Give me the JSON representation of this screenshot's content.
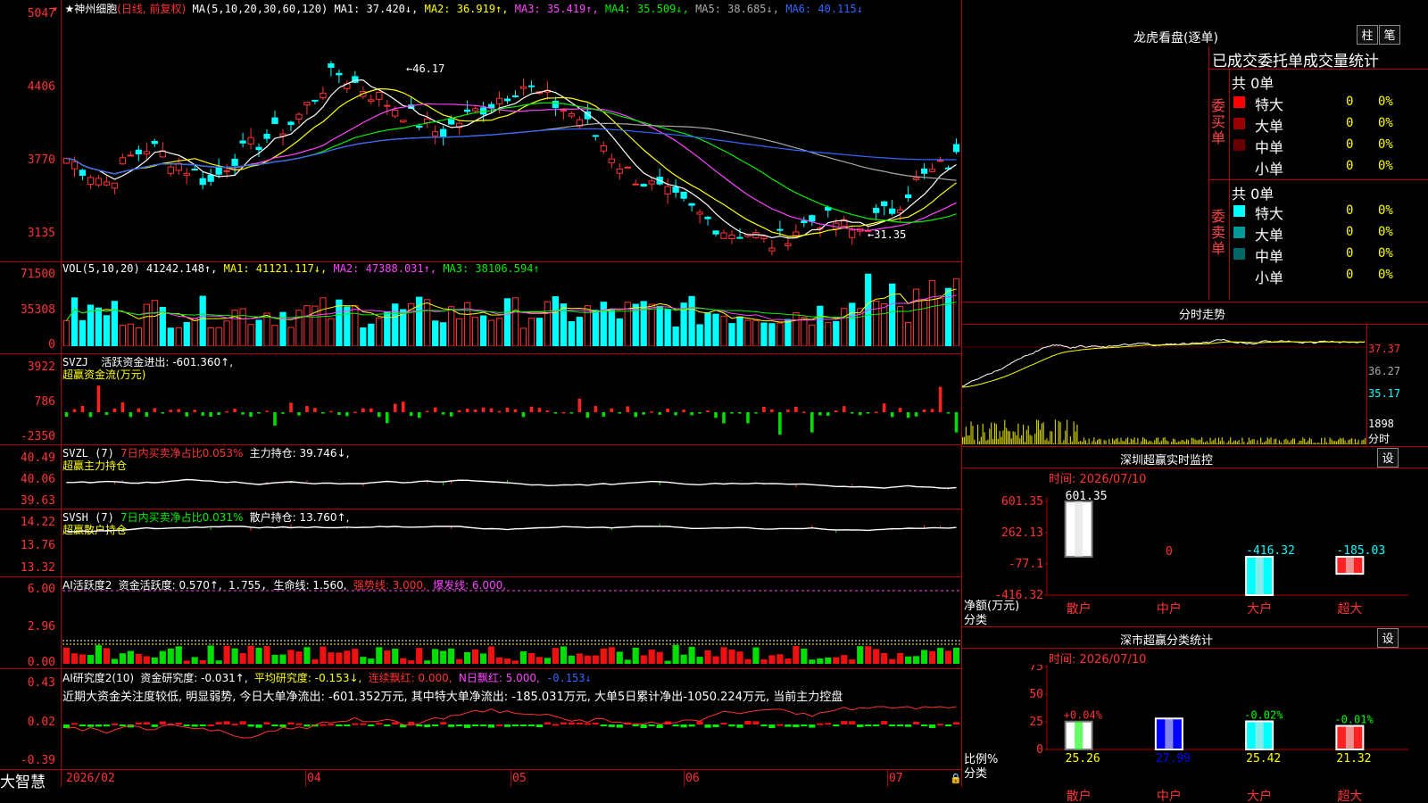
{
  "stock": {
    "name": "神州细胞",
    "mode": "(日线, 前复权)"
  },
  "ma_header": {
    "params": "MA(5,10,20,30,60,120)",
    "ma1": "MA1: 37.420↓,",
    "ma2": "MA2: 36.919↑,",
    "ma3": "MA3: 35.419↑,",
    "ma4": "MA4: 35.509↓,",
    "ma5": "MA5: 38.685↓,",
    "ma6": "MA6: 40.115↓"
  },
  "price_axis": [
    "5047",
    "4406",
    "3770",
    "3135"
  ],
  "price_notes": {
    "high": "46.17",
    "low": "31.35"
  },
  "vol": {
    "header": "VOL(5,10,20)",
    "val": "41242.148↑,",
    "ma1": "MA1: 41121.117↓,",
    "ma2": "MA2: 47388.031↑,",
    "ma3": "MA3: 38106.594↑",
    "axis": [
      "71500",
      "35308",
      "0"
    ]
  },
  "svzj": {
    "title": "SVZJ",
    "label": "活跃资金进出: -601.360↑,",
    "sub": "超赢资金流(万元)",
    "axis": [
      "3922",
      "786",
      "-2350"
    ]
  },
  "svzl": {
    "title": "SVZL (7)",
    "ratio": "7日内买卖净占比0.053%",
    "hold": "主力持仓: 39.746↓,",
    "sub": "超赢主力持仓",
    "axis": [
      "40.49",
      "40.06",
      "39.63"
    ]
  },
  "svsh": {
    "title": "SVSH (7)",
    "ratio": "7日内买卖净占比0.031%",
    "hold": "散户持仓: 13.760↑,",
    "sub": "超赢散户持仓",
    "axis": [
      "14.22",
      "13.76",
      "13.32"
    ]
  },
  "ai_active": {
    "title": "AI活跃度2",
    "a": "资金活跃度: 0.570↑,",
    "b": "1.755,",
    "c": "生命线: 1.560,",
    "d": "强势线: 3.000,",
    "e": "爆发线: 6.000,",
    "axis": [
      "6.00",
      "2.96",
      "0.00"
    ]
  },
  "ai_research": {
    "title": "AI研究度2(10)",
    "a": "资金研究度: -0.031↑,",
    "b": "平均研究度: -0.153↓,",
    "c": "连续飘红: 0.000,",
    "d": "N日飘红: 5.000,",
    "e": "-0.153↓",
    "desc": "近期大资金关注度较低, 明显弱势, 今日大单净流出: -601.352万元, 其中特大单净流出: -185.031万元, 大单5日累计净出-1050.224万元, 当前主力控盘",
    "axis": [
      "0.43",
      "0.02",
      "-0.39"
    ]
  },
  "date_axis": [
    "2026/02",
    "04",
    "05",
    "06",
    "07"
  ],
  "brand": "大智慧",
  "right": {
    "dragon_title": "龙虎看盘(逐单)",
    "btn_zhu": "柱",
    "btn_bi": "笔",
    "tabs": "已成交委托单成交量统计",
    "buy": {
      "total": "共 0单",
      "side": "委买单",
      "rows": [
        {
          "label": "特大",
          "n": "0",
          "pct": "0%",
          "color": "#ff0000"
        },
        {
          "label": "大单",
          "n": "0",
          "pct": "0%",
          "color": "#990000"
        },
        {
          "label": "中单",
          "n": "0",
          "pct": "0%",
          "color": "#660000"
        },
        {
          "label": "小单",
          "n": "0",
          "pct": "0%",
          "color": "#000000"
        }
      ]
    },
    "sell": {
      "total": "共 0单",
      "side": "委卖单",
      "rows": [
        {
          "label": "特大",
          "n": "0",
          "pct": "0%",
          "color": "#00ffff"
        },
        {
          "label": "大单",
          "n": "0",
          "pct": "0%",
          "color": "#009999"
        },
        {
          "label": "中单",
          "n": "0",
          "pct": "0%",
          "color": "#006666"
        },
        {
          "label": "小单",
          "n": "0",
          "pct": "0%",
          "color": "#000000"
        }
      ]
    },
    "minute_title": "分时走势",
    "minute_axis": [
      "37.37",
      "36.27",
      "35.17",
      "1898",
      "分时"
    ],
    "monitor": {
      "title": "深圳超赢实时监控",
      "btn": "设",
      "time": "时间: 2026/07/10",
      "axis": [
        "601.35",
        "262.13",
        "-77.1",
        "-416.32"
      ],
      "unit": "净额(万元)",
      "cat_label": "分类",
      "bars": [
        {
          "cat": "散户",
          "value": "601.35"
        },
        {
          "cat": "中户",
          "value": "0"
        },
        {
          "cat": "大户",
          "value": "-416.32"
        },
        {
          "cat": "超大",
          "value": "-185.03"
        }
      ]
    },
    "stats": {
      "title": "深市超赢分类统计",
      "btn": "设",
      "time": "时间: 2026/07/10",
      "axis": [
        "75",
        "50",
        "25",
        "0"
      ],
      "unit": "比例%",
      "cat_label": "分类",
      "bars": [
        {
          "cat": "散户",
          "value": "25.26",
          "chg": "+0.04%"
        },
        {
          "cat": "中户",
          "value": "27.99",
          "chg": ""
        },
        {
          "cat": "大户",
          "value": "25.42",
          "chg": "-0.02%"
        },
        {
          "cat": "超大",
          "value": "21.32",
          "chg": "-0.01%"
        }
      ]
    }
  }
}
